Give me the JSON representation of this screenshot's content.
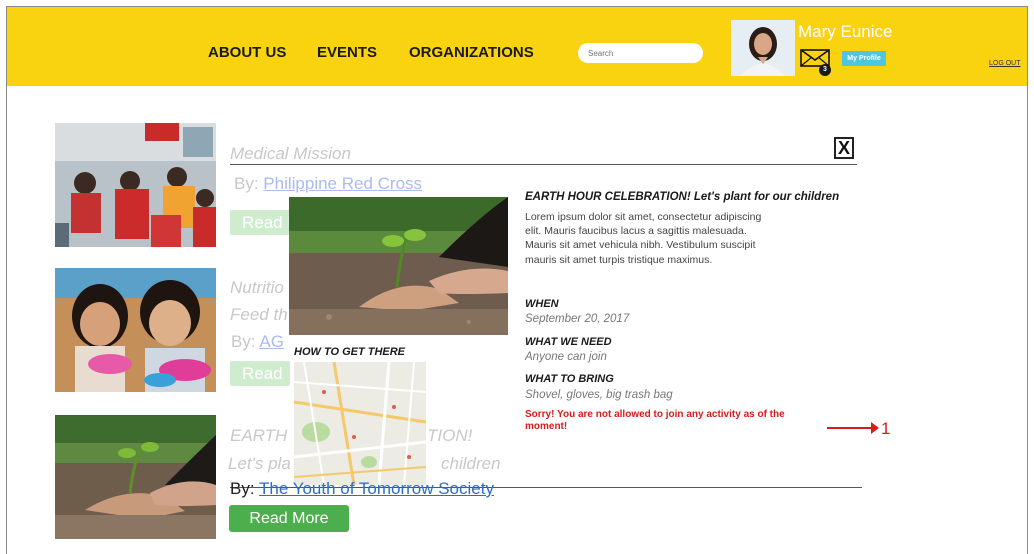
{
  "header": {
    "nav": [
      "ABOUT US",
      "EVENTS",
      "ORGANIZATIONS"
    ],
    "search_placeholder": "Search",
    "user_name": "Mary Eunice",
    "mail_count": "3",
    "profile_label": "My Profile",
    "logout_label": "LOG OUT"
  },
  "cards": [
    {
      "title": "Medical Mission",
      "by_prefix": "By:",
      "org": "Philippine Red Cross",
      "read_more": "Read More"
    },
    {
      "title": "Nutritio",
      "subtitle": "Feed th",
      "by_prefix": "By:",
      "org": "AG",
      "read_more": "Read M"
    },
    {
      "title": "EARTH HOUR CELEBRATION!",
      "title_visible_left": "EARTH",
      "title_visible_right": "TION!",
      "subtitle_left": "Let's pla",
      "subtitle_right": "children",
      "by_prefix": "By:",
      "org": "The Youth of Tomorrow Society",
      "read_more": "Read More"
    }
  ],
  "modal": {
    "title": "EARTH HOUR CELEBRATION! Let's plant for our children",
    "description": "Lorem ipsum dolor sit amet, consectetur adipiscing elit. Mauris faucibus lacus a sagittis malesuada. Mauris sit amet vehicula nibh. Vestibulum suscipit mauris sit amet turpis tristique maximus.",
    "when_label": "WHEN",
    "when_value": "September 20, 2017",
    "need_label": "WHAT WE NEED",
    "need_value": "Anyone can join",
    "bring_label": "WHAT TO BRING",
    "bring_value": "Shovel, gloves, big trash bag",
    "warning": "Sorry! You are not allowed to join any activity as of the moment!",
    "how_label": "HOW TO GET THERE",
    "close_label": "X"
  },
  "annotation": {
    "number": "1",
    "color": "#d81c1c"
  },
  "colors": {
    "header": "#f9d310",
    "button": "#4cae4c",
    "profile_button": "#4fc6e0"
  }
}
